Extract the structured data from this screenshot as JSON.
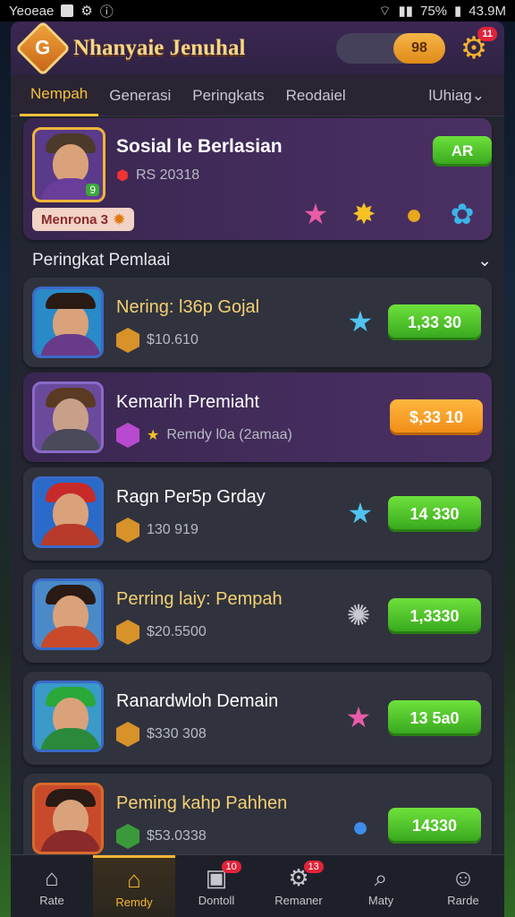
{
  "status_bar": {
    "left": "Yeoeae",
    "battery": "75%",
    "time": "43.9M"
  },
  "header": {
    "title": "Nhanyaie Jenuhal",
    "coins": "98",
    "settings_badge": "11"
  },
  "tabs": [
    {
      "label": "Nempah",
      "active": true
    },
    {
      "label": "Generasi"
    },
    {
      "label": "Peringkats"
    },
    {
      "label": "Reodaiel"
    },
    {
      "label": "lUhiag⌄"
    }
  ],
  "featured": {
    "name": "Sosial le Berlasian",
    "score": "RS 20318",
    "tag": "Menrona 3",
    "avatar_level": "9",
    "button": "AR"
  },
  "section": {
    "title": "Peringkat Pemlaai",
    "chevron": "⌄"
  },
  "players": [
    {
      "name": "Nering: l36p Gojal",
      "score": "$10.610",
      "button": "1,33 30",
      "gem": "star-gem"
    },
    {
      "name": "Kemarih Premiaht",
      "score": "Remdy l0a (2amaa)",
      "button": "$,33 10",
      "gem": "none"
    },
    {
      "name": "Ragn Per5p Grday",
      "score": "130 919",
      "button": "14 330",
      "gem": "star-gem"
    },
    {
      "name": "Perring laiy: Pempah",
      "score": "$20.5500",
      "button": "1,3330",
      "gem": "shell"
    },
    {
      "name": "Ranardwloh Demain",
      "score": "$330 308",
      "button": "13 5a0",
      "gem": "star-gem"
    },
    {
      "name": "Peming kahp Pahhen",
      "score": "$53.0338",
      "button": "14330",
      "gem": "orb"
    }
  ],
  "bottom_nav": [
    {
      "label": "Rate",
      "icon": "home-icon"
    },
    {
      "label": "Remdy",
      "icon": "house-icon",
      "active": true
    },
    {
      "label": "Dontoll",
      "icon": "cube-icon",
      "badge": "10"
    },
    {
      "label": "Remaner",
      "icon": "gear-icon",
      "badge": "13"
    },
    {
      "label": "Maty",
      "icon": "search-icon"
    },
    {
      "label": "Rarde",
      "icon": "user-icon"
    }
  ],
  "colors": {
    "accent": "#f7c13c",
    "button_green": "#4cc52a",
    "button_orange": "#f39a1e",
    "header_purple": "#3c2754"
  }
}
